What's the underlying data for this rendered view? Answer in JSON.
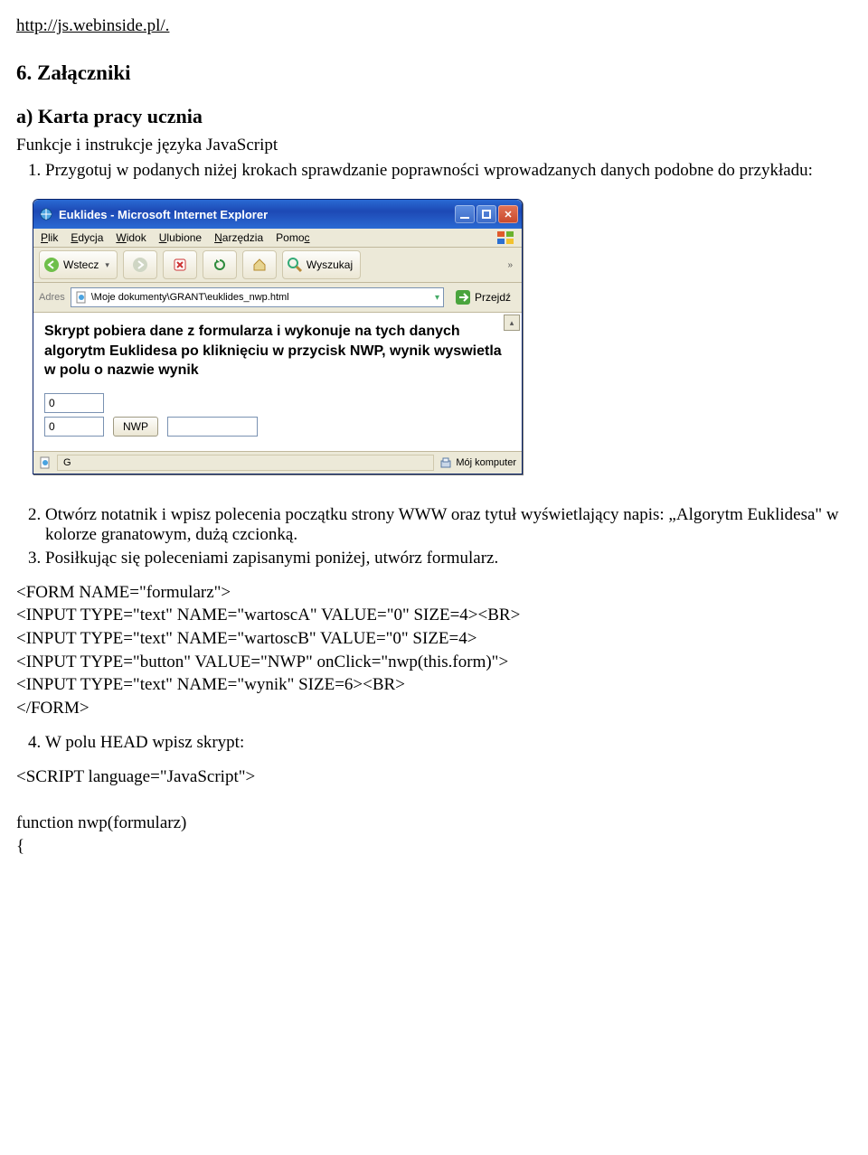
{
  "url_line": "http://js.webinside.pl/.",
  "sec_heading": "6. Załączniki",
  "sub_heading": "a) Karta pracy ucznia",
  "lead": "Funkcje i instrukcje języka JavaScript",
  "steps": {
    "s1": "Przygotuj w podanych niżej krokach sprawdzanie poprawności wprowadzanych danych podobne do przykładu:",
    "s2": "Otwórz notatnik i wpisz polecenia początku strony WWW oraz tytuł wyświetlający napis: „Algorytm Euklidesa\" w kolorze granatowym, dużą czcionką.",
    "s3": "Posiłkując się poleceniami zapisanymi poniżej, utwórz formularz.",
    "s4": "W polu HEAD wpisz skrypt:"
  },
  "code_block_1": "<FORM NAME=\"formularz\">\n<INPUT TYPE=\"text\" NAME=\"wartoscA\" VALUE=\"0\" SIZE=4><BR>\n<INPUT TYPE=\"text\" NAME=\"wartoscB\" VALUE=\"0\" SIZE=4>\n<INPUT TYPE=\"button\" VALUE=\"NWP\" onClick=\"nwp(this.form)\">\n<INPUT TYPE=\"text\" NAME=\"wynik\" SIZE=6><BR>\n</FORM>",
  "code_block_2": "<SCRIPT language=\"JavaScript\">\n\nfunction nwp(formularz)\n{",
  "ie": {
    "title": "Euklides - Microsoft Internet Explorer",
    "menu": {
      "plik": "Plik",
      "edycja": "Edycja",
      "widok": "Widok",
      "ulubione": "Ulubione",
      "narzedzia": "Narzędzia",
      "pomoc": "Pomoc"
    },
    "back": "Wstecz",
    "search": "Wyszukaj",
    "addr_label": "Adres",
    "addr_value": "\\Moje dokumenty\\GRANT\\euklides_nwp.html",
    "go": "Przejdź",
    "skrypt": "Skrypt pobiera dane z formularza i wykonuje na tych danych algorytm Euklidesa po kliknięciu w przycisk NWP, wynik wyswietla w polu o nazwie wynik",
    "valA": "0",
    "valB": "0",
    "nwp_btn": "NWP",
    "wynik": "",
    "status_left": "G",
    "status_zone": "Mój komputer"
  }
}
